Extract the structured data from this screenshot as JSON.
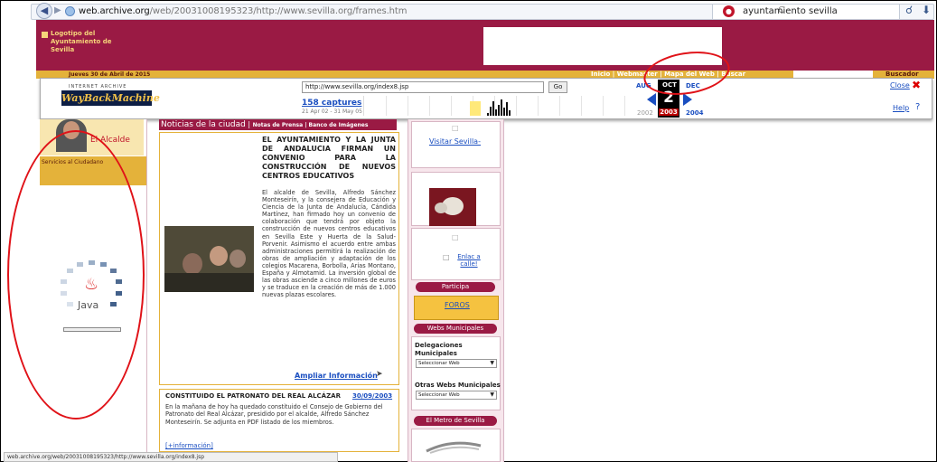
{
  "browser": {
    "url_domain": "web.archive.org",
    "url_rest": "/web/20031008195323/http://www.sevilla.org/frames.htm",
    "search_value": "ayuntamiento sevilla"
  },
  "site": {
    "logo_text": "Logotipo del Ayuntamiento de Sevilla",
    "date": "Jueves 30 de Abril de 2015",
    "nav_links": "Inicio | Webmaster | Mapa del Web | Buscar",
    "search_label": "Buscador"
  },
  "wayback": {
    "small_text": "INTERNET ARCHIVE",
    "logo": "WayBackMachine",
    "url_value": "http://www.sevilla.org/index8.jsp",
    "go_label": "Go",
    "captures": "158 captures",
    "captures_range": "21 Apr 02 - 31 May 05",
    "month_prev": "AUG",
    "month_cur": "OCT",
    "month_next": "DEC",
    "day": "2",
    "year_prev": "2002",
    "year_cur": "2003",
    "year_next": "2004",
    "close": "Close",
    "help": "Help",
    "sparkline": [
      3,
      9,
      14,
      6,
      11,
      16,
      8,
      13,
      5
    ]
  },
  "left": {
    "mayor_label": "El Alcalde",
    "services": "Servicios al Ciudadano",
    "java_label": "Java"
  },
  "news": {
    "tab_title": "Noticias de la ciudad",
    "tab_links": "Notas de Prensa | Banco de Imágenes",
    "headline": "EL AYUNTAMIENTO Y LA JUNTA DE ANDALUCIA FIRMAN UN CONVENIO PARA LA CONSTRUCCIÓN DE NUEVOS CENTROS EDUCATIVOS",
    "body": "El alcalde de Sevilla, Alfredo Sánchez Monteseirín, y la consejera de Educación y Ciencia de la Junta de Andalucía, Cándida Martínez, han firmado hoy un convenio de colaboración que tendrá por objeto la construcción de nuevos centros educativos en Sevilla Este y Huerta de la Salud-Porvenir. Asimismo el acuerdo entre ambas administraciones permitirá la realización de obras de ampliación y adaptación de los colegios Macarena, Borbolla, Arias Montano, España y Almotamid. La inversión global de las obras asciende a cinco millones de euros y se traduce en la creación de más de 1.000 nuevas plazas escolares.",
    "more": "Ampliar Información",
    "item2_title": "CONSTITUIDO EL PATRONATO DEL REAL ALCÁZAR",
    "item2_date": "30/09/2003",
    "item2_body": "En la mañana de hoy ha quedado constituido el Consejo de Gobierno del Patronato del Real Alcázar, presidido por el alcalde, Alfredo Sánchez Monteseirín. Se adjunta en PDF listado de los miembros.",
    "item2_more": "[+información]"
  },
  "right": {
    "visit": "Visitar Sevilla-",
    "links": "Enlac a calle!",
    "participa": "Participa",
    "foros": "FOROS",
    "webs": "Webs Municipales",
    "delegaciones": "Delegaciones Municipales",
    "select1": "Seleccionar Web",
    "otras": "Otras Webs Municipales",
    "select2": "Seleccionar Web",
    "metro": "El Metro de Sevilla"
  },
  "status": {
    "text": "web.archive.org/web/20031008195323/http://www.sevilla.org/index8.jsp"
  },
  "colors": {
    "accent": "#9a1a44",
    "gold": "#e4b23a",
    "annotation": "#e01218"
  }
}
